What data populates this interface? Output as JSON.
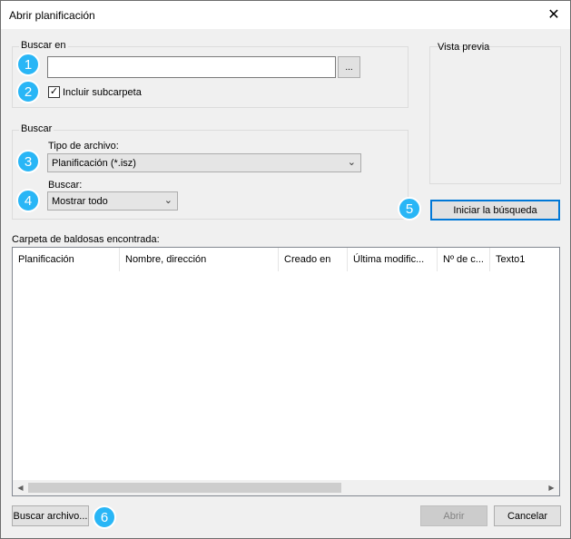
{
  "window": {
    "title": "Abrir planificación",
    "close_glyph": "✕"
  },
  "search_in": {
    "group_label": "Buscar en",
    "path_value": "",
    "browse_label": "...",
    "include_subfolder_checked": true,
    "include_subfolder_label": "Incluir subcarpeta"
  },
  "preview": {
    "label": "Vista previa"
  },
  "search": {
    "group_label": "Buscar",
    "file_type_label": "Tipo de archivo:",
    "file_type_value": "Planificación (*.isz)",
    "search_label": "Buscar:",
    "search_value": "Mostrar todo"
  },
  "start_search_label": "Iniciar la búsqueda",
  "results": {
    "label": "Carpeta de baldosas encontrada:",
    "columns": [
      "Planificación",
      "Nombre, dirección",
      "Creado en",
      "Última modific...",
      "Nº de c...",
      "Texto1"
    ]
  },
  "footer": {
    "find_file_label": "Buscar archivo...",
    "open_label": "Abrir",
    "cancel_label": "Cancelar"
  },
  "badges": [
    "1",
    "2",
    "3",
    "4",
    "5",
    "6"
  ],
  "colors": {
    "badge": "#29b6f6",
    "focus": "#0078d7"
  }
}
